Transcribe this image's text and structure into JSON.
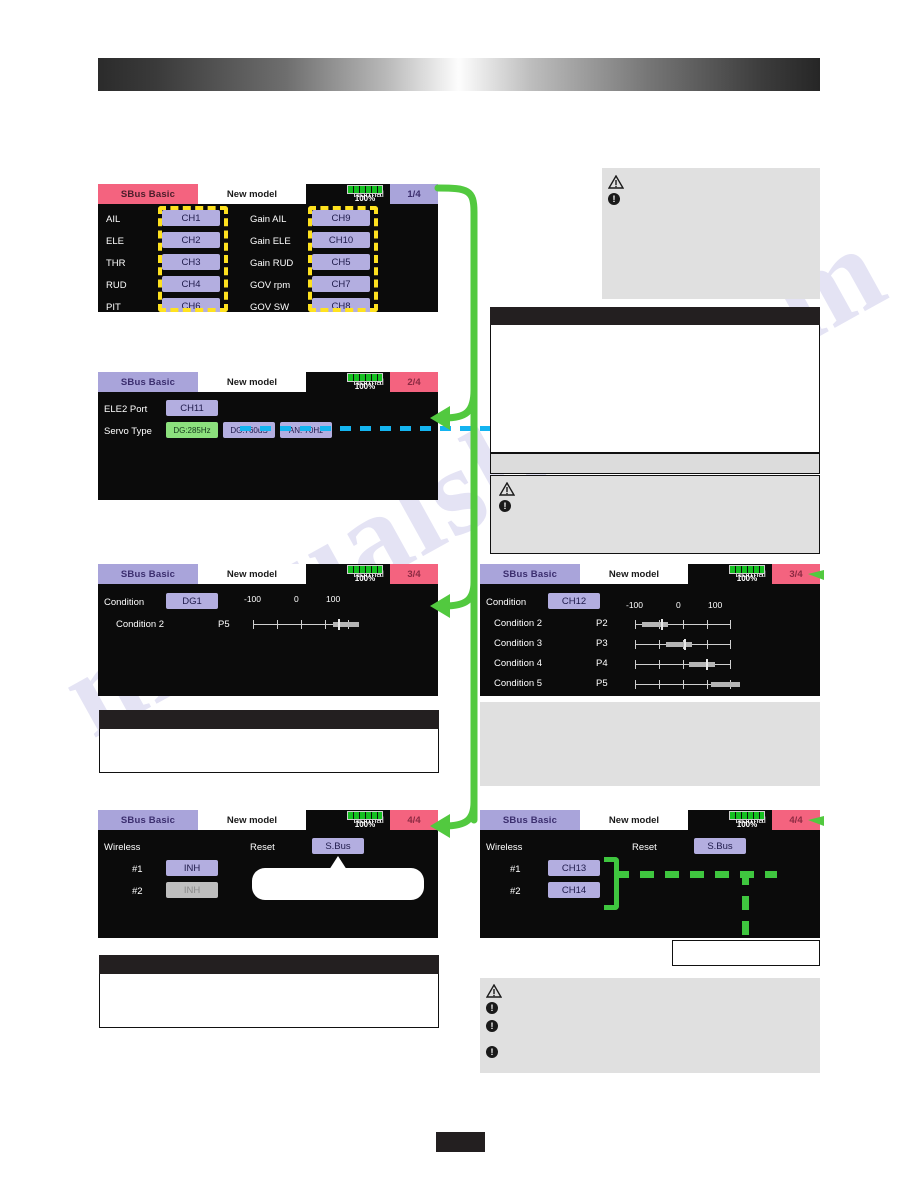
{
  "document": {
    "watermark": "manualslive.com"
  },
  "screens": [
    {
      "id": "sbus-basic-1of4",
      "title": "SBus Basic",
      "model": "New model",
      "condition": "Normal",
      "battery": "100%",
      "page": "1/4",
      "title_style": "pink",
      "page_style": "purple",
      "left_rows": [
        {
          "label": "AIL",
          "value": "CH1"
        },
        {
          "label": "ELE",
          "value": "CH2"
        },
        {
          "label": "THR",
          "value": "CH3"
        },
        {
          "label": "RUD",
          "value": "CH4"
        },
        {
          "label": "PIT",
          "value": "CH6"
        }
      ],
      "right_rows": [
        {
          "label": "Gain AIL",
          "value": "CH9"
        },
        {
          "label": "Gain ELE",
          "value": "CH10"
        },
        {
          "label": "Gain RUD",
          "value": "CH5"
        },
        {
          "label": "GOV rpm",
          "value": "CH7"
        },
        {
          "label": "GOV SW",
          "value": "CH8"
        }
      ]
    },
    {
      "id": "sbus-basic-2of4",
      "title": "SBus Basic",
      "model": "New model",
      "condition": "Normal",
      "battery": "100%",
      "page": "2/4",
      "title_style": "purple",
      "page_style": "pink",
      "ele2_label": "ELE2 Port",
      "ele2_value": "CH11",
      "servo_label": "Servo Type",
      "servo_options": [
        "DG:285Hz",
        "DG:760uS",
        "AN: 70Hz"
      ],
      "servo_selected": "DG:285Hz"
    },
    {
      "id": "sbus-basic-3of4-left",
      "title": "SBus Basic",
      "model": "New model",
      "condition": "Normal",
      "battery": "100%",
      "page": "3/4",
      "title_style": "purple",
      "page_style": "pink",
      "condition_label": "Condition",
      "condition_value": "DG1",
      "scale": [
        "-100",
        "0",
        "100"
      ],
      "rows": [
        {
          "label": "Condition 2",
          "value": "P5",
          "position": 82
        }
      ]
    },
    {
      "id": "sbus-basic-3of4-right",
      "title": "SBus Basic",
      "model": "New model",
      "condition": "Normal",
      "battery": "100%",
      "page": "3/4",
      "title_style": "purple",
      "page_style": "pink",
      "condition_label": "Condition",
      "condition_value": "CH12",
      "scale": [
        "-100",
        "0",
        "100"
      ],
      "rows": [
        {
          "label": "Condition 2",
          "value": "P2",
          "position": 18
        },
        {
          "label": "Condition 3",
          "value": "P3",
          "position": 40
        },
        {
          "label": "Condition 4",
          "value": "P4",
          "position": 62
        },
        {
          "label": "Condition 5",
          "value": "P5",
          "position": 85
        }
      ]
    },
    {
      "id": "sbus-basic-4of4-left",
      "title": "SBus Basic",
      "model": "New model",
      "condition": "Normal",
      "battery": "100%",
      "page": "4/4",
      "title_style": "purple",
      "page_style": "pink",
      "wireless_label": "Wireless",
      "reset_label": "Reset",
      "reset_value": "S.Bus",
      "rows": [
        {
          "label": "#1",
          "value": "INH",
          "style": "normal"
        },
        {
          "label": "#2",
          "value": "INH",
          "style": "disabled"
        }
      ]
    },
    {
      "id": "sbus-basic-4of4-right",
      "title": "SBus Basic",
      "model": "New model",
      "condition": "Normal",
      "battery": "100%",
      "page": "4/4",
      "title_style": "purple",
      "page_style": "pink",
      "wireless_label": "Wireless",
      "reset_label": "Reset",
      "reset_value": "S.Bus",
      "rows": [
        {
          "label": "#1",
          "value": "CH13",
          "style": "normal"
        },
        {
          "label": "#2",
          "value": "CH14",
          "style": "normal"
        }
      ]
    }
  ],
  "notes": {
    "right_top_caution": {
      "warning_icon": "warning-triangle-icon",
      "note_icon": "exclamation-dot-icon"
    },
    "right_mid_panel": {
      "header": "",
      "body": "",
      "subheader": "",
      "caution_icon": "warning-triangle-icon",
      "note_icon": "exclamation-dot-icon"
    },
    "left_note_1": {
      "header": "",
      "body": ""
    },
    "left_note_2": {
      "header": "",
      "body": ""
    },
    "right_gray_1": {
      "body": ""
    },
    "right_bottom_callout": {
      "body": ""
    },
    "right_bottom_caution": {
      "warning_icon": "warning-triangle-icon",
      "note_icons": [
        "exclamation-dot-icon",
        "exclamation-dot-icon",
        "exclamation-dot-icon"
      ]
    }
  },
  "footer": {
    "page_number": ""
  },
  "colors": {
    "accent_pink": "#f4637f",
    "accent_purple": "#a9a4da",
    "highlight_yellow": "#ffe21f",
    "flow_green": "#3fc63f",
    "flow_cyan": "#14b4f0",
    "selected_green": "#8ce07d"
  }
}
